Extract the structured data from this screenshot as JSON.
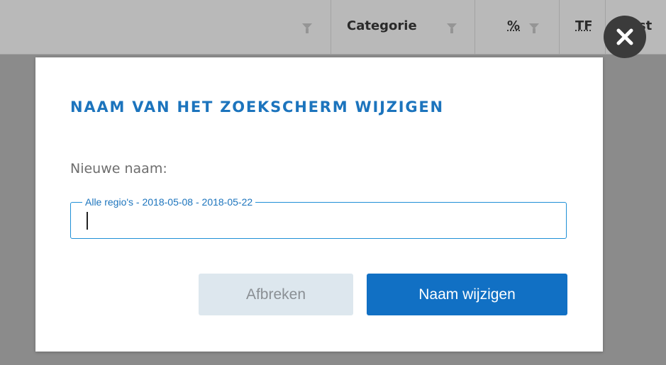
{
  "table_header": {
    "columns": [
      {
        "label": ""
      },
      {
        "label": "Categorie"
      },
      {
        "label": "%"
      },
      {
        "label": "TF"
      },
      {
        "label": "Best"
      }
    ]
  },
  "dialog": {
    "title": "NAAM VAN HET ZOEKSCHERM WIJZIGEN",
    "field_label": "Nieuwe naam:",
    "input": {
      "floating_label": "Alle regio's - 2018-05-08 - 2018-05-22",
      "value": ""
    },
    "cancel_label": "Afbreken",
    "confirm_label": "Naam wijzigen"
  },
  "icons": {
    "close": "close-icon",
    "filter": "filter-icon"
  },
  "colors": {
    "accent": "#1c74bd",
    "primary_button": "#1170c4",
    "cancel_button": "#dde7ee",
    "close_button": "#3b3b3b",
    "overlay": "#8b8b8b"
  }
}
